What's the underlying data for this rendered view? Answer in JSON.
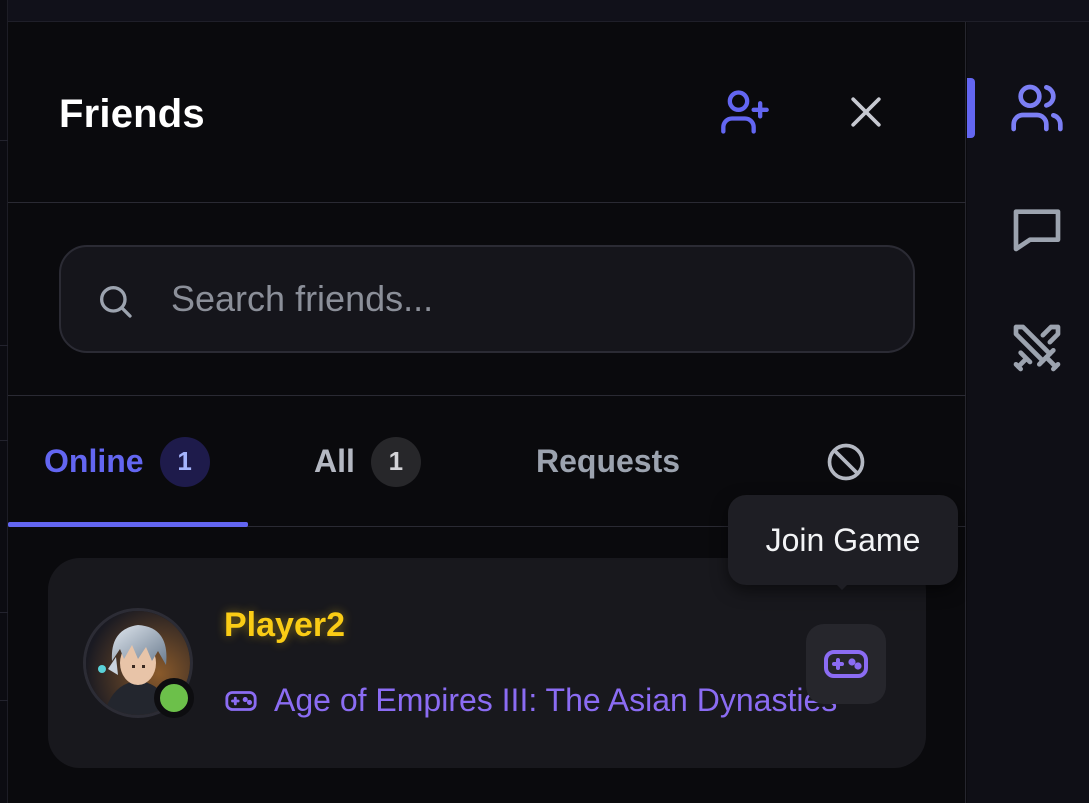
{
  "panel": {
    "title": "Friends",
    "icons": {
      "add_friend": "user-plus-icon",
      "close": "close-icon"
    }
  },
  "search": {
    "placeholder": "Search friends...",
    "value": "",
    "icon": "search-icon"
  },
  "tabs": [
    {
      "label": "Online",
      "count": "1",
      "active": true
    },
    {
      "label": "All",
      "count": "1",
      "active": false
    },
    {
      "label": "Requests",
      "active": false
    },
    {
      "icon": "blocked-icon",
      "active": false
    }
  ],
  "friends": [
    {
      "name": "Player2",
      "status": "online",
      "game": "Age of Empires III: The Asian Dynasties",
      "game_icon": "gamepad-icon",
      "action_icon": "gamepad-icon",
      "action_tooltip": "Join Game"
    }
  ],
  "rail": {
    "items": [
      {
        "icon": "users-icon",
        "active": true
      },
      {
        "icon": "chat-icon",
        "active": false
      },
      {
        "icon": "crossed-swords-icon",
        "active": false
      }
    ]
  },
  "colors": {
    "accent": "#6366f1",
    "player_name": "#facc15",
    "game_text": "#8b6cf3",
    "online_status": "#6cc04a",
    "background": "#0a0a0d"
  }
}
